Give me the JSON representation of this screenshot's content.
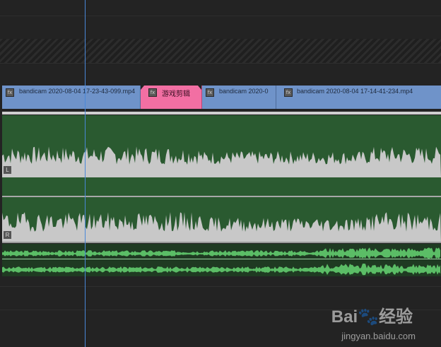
{
  "timeline": {
    "video_clips": [
      {
        "label": "bandicam 2020-08-04 17-23-43-099.mp4",
        "color": "#6f93c9",
        "fx_icon": "fx-icon"
      },
      {
        "label": "游戏剪辑",
        "color": "#f26fa3",
        "fx_icon": "fx-icon"
      },
      {
        "label": "bandicam 2020-0",
        "color": "#6f93c9",
        "fx_icon": "fx-icon"
      },
      {
        "label": "bandicam 2020-08-04 17-14-41-234.mp4",
        "color": "#6f93c9",
        "fx_icon": "fx-icon"
      }
    ],
    "audio_channels": [
      {
        "label": "L",
        "fill": "#2a5a30",
        "wave": "#c8c8c8"
      },
      {
        "label": "R",
        "fill": "#2a5a30",
        "wave": "#c8c8c8"
      }
    ],
    "secondary_audio_color": "#5bbd66",
    "playhead_color": "#4a88d8",
    "clip_fx_glyph": "fx"
  },
  "watermark": {
    "logo": "Bai🐾经验",
    "url": "jingyan.baidu.com"
  }
}
